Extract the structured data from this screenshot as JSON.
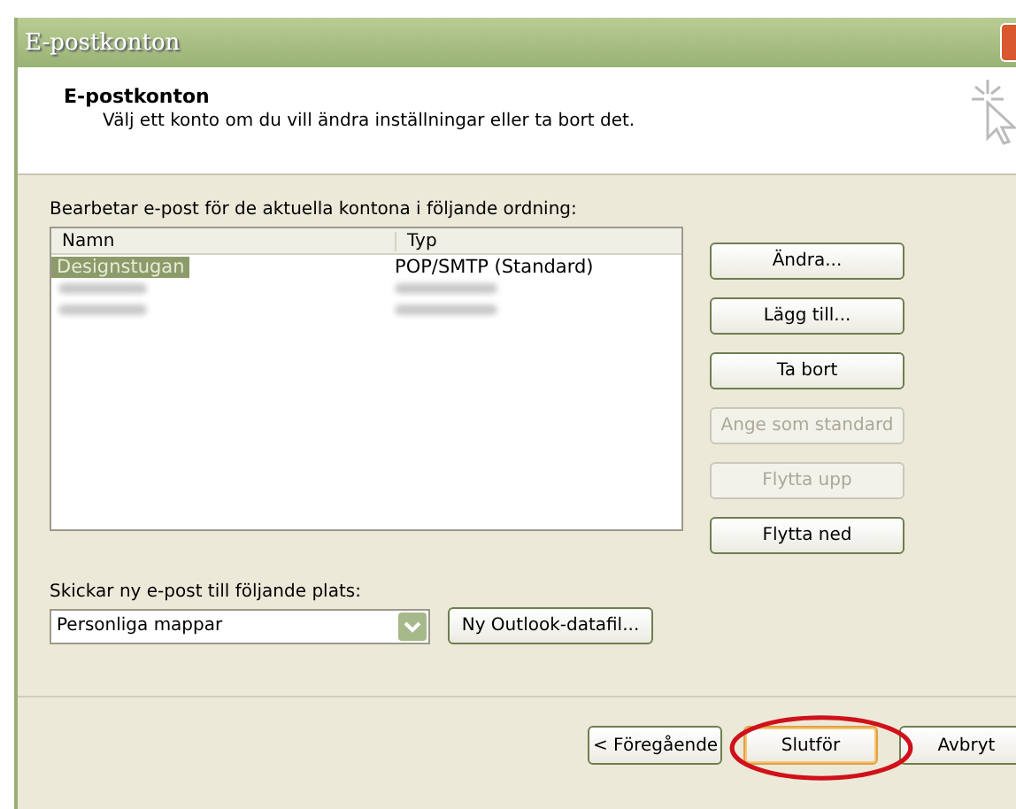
{
  "window": {
    "title": "E-postkonton"
  },
  "header": {
    "title": "E-postkonton",
    "subtitle": "Välj ett konto om du vill ändra inställningar eller ta bort det."
  },
  "accounts": {
    "caption": "Bearbetar e-post för de aktuella kontona i följande ordning:",
    "columns": [
      "Namn",
      "Typ"
    ],
    "rows": [
      {
        "kind": "text",
        "name": "Designstugan",
        "type": "POP/SMTP (Standard)",
        "selected": true
      },
      {
        "kind": "blurred",
        "selected": false
      },
      {
        "kind": "blurred",
        "selected": false
      }
    ]
  },
  "side_buttons": [
    {
      "label": "Ändra...",
      "disabled": false
    },
    {
      "label": "Lägg till...",
      "disabled": false
    },
    {
      "label": "Ta bort",
      "disabled": false
    },
    {
      "label": "Ange som standard",
      "disabled": true
    },
    {
      "label": "Flytta upp",
      "disabled": true
    },
    {
      "label": "Flytta ned",
      "disabled": false
    }
  ],
  "delivery": {
    "label": "Skickar ny e-post till följande plats:",
    "value": "Personliga mappar",
    "button": {
      "label": "Ny Outlook-datafil..."
    }
  },
  "footer_buttons": [
    {
      "label": "< Föregående",
      "highlighted": false
    },
    {
      "label": "Slutför",
      "highlighted": true
    },
    {
      "label": "Avbryt",
      "highlighted": false
    }
  ]
}
